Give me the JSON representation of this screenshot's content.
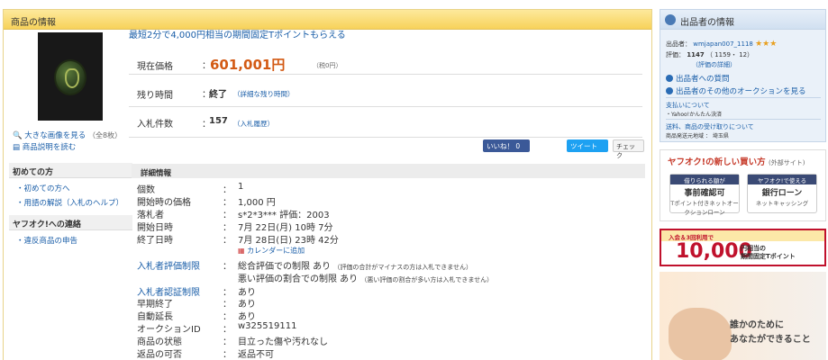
{
  "main_header": "商品の情報",
  "image_links": {
    "large_image": "大きな画像を見る",
    "large_count": "（全8枚）",
    "description": "商品説明を読む"
  },
  "promo": "最短2分で4,000円相当の期間固定Tポイントもらえる",
  "price": {
    "label": "現在価格",
    "colon": "：",
    "value": "601,001円",
    "tax": "（税0円）"
  },
  "time": {
    "label": "残り時間",
    "colon": "：",
    "value": "終了",
    "detail": "（詳細な残り時間）"
  },
  "bids": {
    "label": "入札件数",
    "colon": "：",
    "value": "157",
    "history": "（入札履歴）"
  },
  "social": {
    "like": "いいね！ 0",
    "tweet": "ツイート",
    "check": "チェック"
  },
  "left_sidebar": {
    "first_title": "初めての方",
    "first_items": [
      "・初めての方へ",
      "・用語の解説（入札のヘルプ）"
    ],
    "contact_title": "ヤフオク!への連絡",
    "contact_items": [
      "・違反商品の申告"
    ]
  },
  "details": {
    "title": "詳細情報",
    "rows": [
      {
        "k": "個数",
        "v": "1"
      },
      {
        "k": "開始時の価格",
        "v": "1,000 円"
      },
      {
        "k": "落札者",
        "v": "s*2*3*** 評価：2003"
      },
      {
        "k": "開始日時",
        "v": "7月 22日(月) 10時 7分"
      },
      {
        "k": "終了日時",
        "v": "7月 28日(日) 23時 42分"
      }
    ],
    "calendar": "カレンダーに追加",
    "limit_label": "入札者評価制限",
    "limit_1": "総合評価での制限 あり",
    "limit_1_note": "（評価の合計がマイナスの方は入札できません）",
    "limit_2": "悪い評価の割合での制限 あり",
    "limit_2_note": "（悪い評価の割合が多い方は入札できません）",
    "auth_label": "入札者認証制限",
    "auth_v": "あり",
    "rows2": [
      {
        "k": "早期終了",
        "v": "あり"
      },
      {
        "k": "自動延長",
        "v": "あり"
      },
      {
        "k": "オークションID",
        "v": "w325519111"
      },
      {
        "k": "商品の状態",
        "v": "目立った傷や汚れなし"
      },
      {
        "k": "返品の可否",
        "v": "返品不可"
      }
    ]
  },
  "seller": {
    "title": "出品者の情報",
    "name_label": "出品者：",
    "name": "wmjapan007_1118",
    "rating_label": "評価：",
    "rating": "1147",
    "rating_detail": "（ 1159・ 12）",
    "rating_link": "（評価の詳細）",
    "question": "出品者への質問",
    "other": "出品者のその他のオークションを見る",
    "pay_title": "支払いについて",
    "pay": "・Yahoo!かんたん決済",
    "ship_title": "送料、商品の受け取りについて",
    "ship": "商品発送元地域 ： 埼玉県"
  },
  "ad1": {
    "title": "ヤフオク!の新しい買い方",
    "title_note": "(外部サイト)",
    "box1_h": "借りられる額が",
    "box1_b": "事前確認可",
    "box1_s": "Tポイント付きネットオークションローン",
    "box2_h": "ヤフオク!で使える",
    "box2_b": "銀行ローン",
    "box2_s": "ネットキャッシング"
  },
  "ad2": {
    "top": "入会＆3回利用で",
    "big": "10,000",
    "yen": "円相当の",
    "yen2": "期間固定Tポイント"
  },
  "ad3": {
    "line1": "誰かのために",
    "line2": "あなたができること"
  }
}
